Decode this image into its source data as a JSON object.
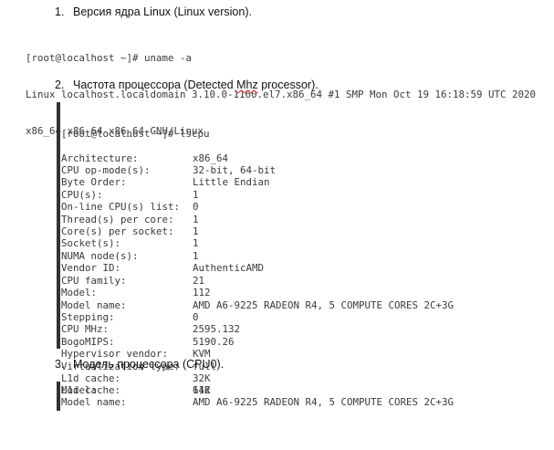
{
  "sections": [
    {
      "number": "1.",
      "title": "Версия ядра Linux (Linux version)."
    },
    {
      "number": "2.",
      "title_before": "Частота процессора (Detected ",
      "title_misspelled": "Mhz",
      "title_after": " processor)."
    },
    {
      "number": "3.",
      "title": "Модель процессора (CPU0)."
    }
  ],
  "uname": {
    "lines": [
      "[root@localhost ~]# uname -a",
      "Linux localhost.localdomain 3.10.0-1160.el7.x86_64 #1 SMP Mon Oct 19 16:18:59 UTC 2020",
      "x86_64 x86_64 x86_64 GNU/Linux"
    ]
  },
  "lscpu": {
    "prompt": "[root@localhost ~]# lscpu",
    "rows": [
      {
        "k": "Architecture:",
        "v": "x86_64"
      },
      {
        "k": "CPU op-mode(s):",
        "v": "32-bit, 64-bit"
      },
      {
        "k": "Byte Order:",
        "v": "Little Endian"
      },
      {
        "k": "CPU(s):",
        "v": "1"
      },
      {
        "k": "On-line CPU(s) list:",
        "v": "0"
      },
      {
        "k": "Thread(s) per core:",
        "v": "1"
      },
      {
        "k": "Core(s) per socket:",
        "v": "1"
      },
      {
        "k": "Socket(s):",
        "v": "1"
      },
      {
        "k": "NUMA node(s):",
        "v": "1"
      },
      {
        "k": "Vendor ID:",
        "v": "AuthenticAMD"
      },
      {
        "k": "CPU family:",
        "v": "21"
      },
      {
        "k": "Model:",
        "v": "112"
      },
      {
        "k": "Model name:",
        "v": "AMD A6-9225 RADEON R4, 5 COMPUTE CORES 2C+3G"
      },
      {
        "k": "Stepping:",
        "v": "0"
      },
      {
        "k": "CPU MHz:",
        "v": "2595.132"
      },
      {
        "k": "BogoMIPS:",
        "v": "5190.26"
      },
      {
        "k": "Hypervisor vendor:",
        "v": "KVM"
      },
      {
        "k": "Virtualization type:",
        "v": "full"
      },
      {
        "k": "L1d cache:",
        "v": "32K"
      },
      {
        "k": "L1i cache:",
        "v": "64K"
      }
    ]
  },
  "cpu0": {
    "rows": [
      {
        "k": "Model:",
        "v": "112"
      },
      {
        "k": "Model name:",
        "v": "AMD A6-9225 RADEON R4, 5 COMPUTE CORES 2C+3G"
      }
    ]
  }
}
